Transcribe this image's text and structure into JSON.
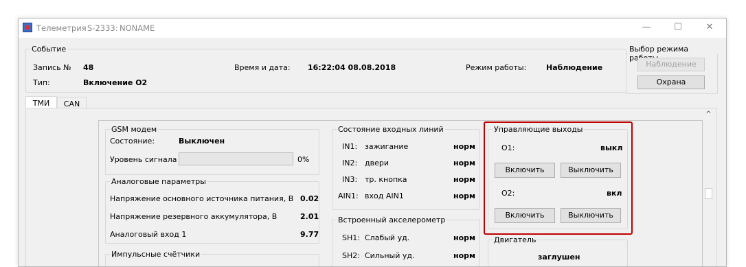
{
  "window": {
    "title": "Телеметрия",
    "device": "S-2333:",
    "name": "NONAME",
    "minimize_glyph": "—",
    "maximize_glyph": "☐",
    "close_glyph": "✕"
  },
  "event": {
    "legend": "Событие",
    "record_label": "Запись №",
    "record_value": "48",
    "type_label": "Тип:",
    "type_value": "Включение О2",
    "datetime_label": "Время и дата:",
    "datetime_value": "16:22:04 08.08.2018",
    "mode_label": "Режим работы:",
    "mode_value": "Наблюдение"
  },
  "mode_select": {
    "legend": "Выбор режима работы",
    "observe_button": "Наблюдение",
    "guard_button": "Охрана"
  },
  "tabs": [
    {
      "label": "ТМИ",
      "active": true
    },
    {
      "label": "CAN",
      "active": false
    }
  ],
  "gsm": {
    "legend": "GSM модем",
    "state_label": "Состояние:",
    "state_value": "Выключен",
    "signal_label": "Уровень сигнала",
    "signal_percent": 0,
    "signal_text": "0%"
  },
  "analog": {
    "legend": "Аналоговые параметры",
    "rows": [
      {
        "label": "Напряжение основного источника питания, В",
        "value": "0.02"
      },
      {
        "label": "Напряжение резервного аккумулятора, В",
        "value": "2.01"
      },
      {
        "label": "Аналоговый вход 1",
        "value": "9.77"
      }
    ]
  },
  "pulse": {
    "legend": "Импульсные счётчики"
  },
  "inputs": {
    "legend": "Состояние входных линий",
    "rows": [
      {
        "id": "IN1:",
        "label": "зажигание",
        "value": "норм"
      },
      {
        "id": "IN2:",
        "label": "двери",
        "value": "норм"
      },
      {
        "id": "IN3:",
        "label": "тр. кнопка",
        "value": "норм"
      },
      {
        "id": "AIN1:",
        "label": "вход AIN1",
        "value": "норм"
      }
    ]
  },
  "accel": {
    "legend": "Встроенный акселерометр",
    "rows": [
      {
        "id": "SH1:",
        "label": "Слабый уд.",
        "value": "норм"
      },
      {
        "id": "SH2:",
        "label": "Сильный уд.",
        "value": "норм"
      }
    ]
  },
  "outputs": {
    "legend": "Управляющие выходы",
    "o1_label": "О1:",
    "o1_value": "выкл",
    "o2_label": "О2:",
    "o2_value": "вкл",
    "on_button": "Включить",
    "off_button": "Выключить",
    "highlight_color": "#c00000"
  },
  "engine": {
    "legend": "Двигатель",
    "state": "заглушен"
  },
  "scroll": {
    "up_glyph": "^"
  }
}
